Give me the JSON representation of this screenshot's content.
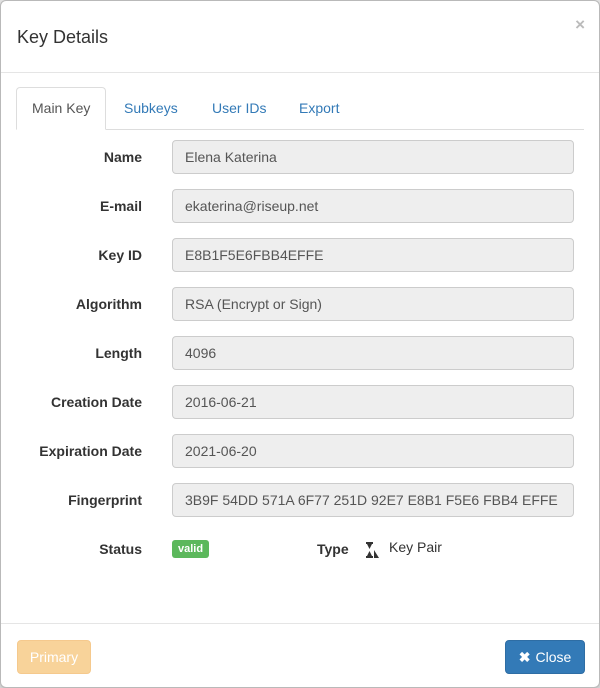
{
  "modal": {
    "title": "Key Details",
    "close_glyph": "×"
  },
  "tabs": [
    {
      "label": "Main Key",
      "active": true
    },
    {
      "label": "Subkeys",
      "active": false
    },
    {
      "label": "User IDs",
      "active": false
    },
    {
      "label": "Export",
      "active": false
    }
  ],
  "fields": {
    "name": {
      "label": "Name",
      "value": "Elena Katerina"
    },
    "email": {
      "label": "E-mail",
      "value": "ekaterina@riseup.net"
    },
    "key_id": {
      "label": "Key ID",
      "value": "E8B1F5E6FBB4EFFE"
    },
    "algorithm": {
      "label": "Algorithm",
      "value": "RSA (Encrypt or Sign)"
    },
    "length": {
      "label": "Length",
      "value": "4096"
    },
    "creation_date": {
      "label": "Creation Date",
      "value": "2016-06-21"
    },
    "expiration_date": {
      "label": "Expiration Date",
      "value": "2021-06-20"
    },
    "fingerprint": {
      "label": "Fingerprint",
      "value": "3B9F 54DD 571A 6F77 251D 92E7 E8B1 F5E6 FBB4 EFFE"
    }
  },
  "status": {
    "label": "Status",
    "badge": "valid",
    "badge_color": "#5cb85c"
  },
  "type": {
    "label": "Type",
    "icon": "key-pair-icon",
    "value": "Key Pair"
  },
  "footer": {
    "primary_label": "Primary",
    "primary_disabled": true,
    "close_label": "Close",
    "close_icon": "close-icon",
    "close_color": "#337ab7"
  }
}
